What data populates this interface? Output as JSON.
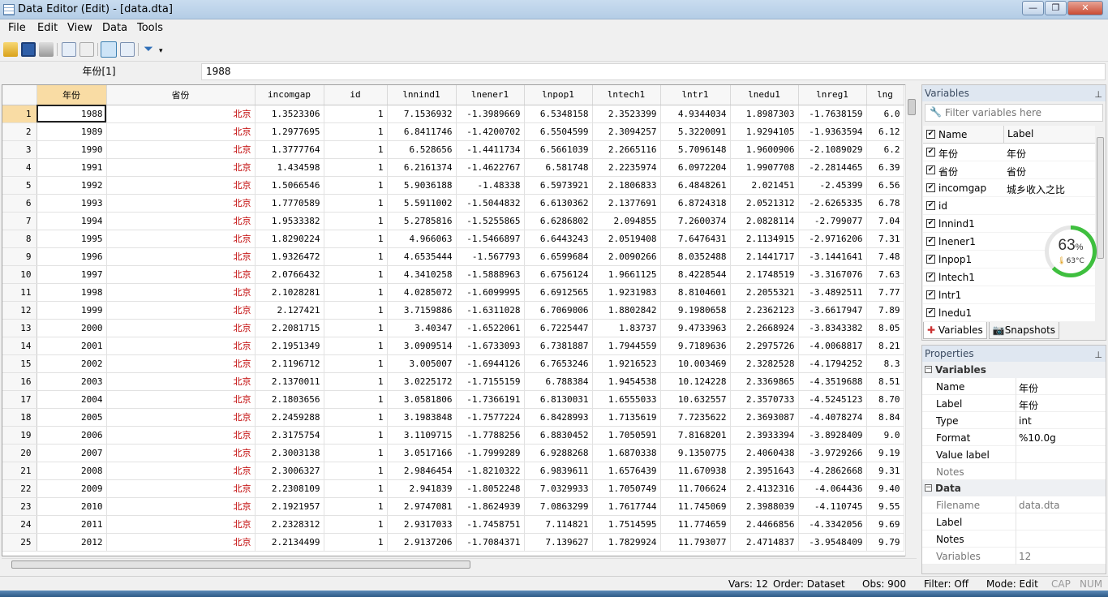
{
  "window": {
    "title": "Data Editor (Edit) - [data.dta]"
  },
  "menu": [
    "File",
    "Edit",
    "View",
    "Data",
    "Tools"
  ],
  "cellbar": {
    "ref": "年份[1]",
    "value": "1988"
  },
  "grid": {
    "columns": [
      "年份",
      "省份",
      "incomgap",
      "id",
      "lnnind1",
      "lnener1",
      "lnpop1",
      "lntech1",
      "lntr1",
      "lnedu1",
      "lnreg1",
      "lng"
    ],
    "rows": [
      [
        "1",
        "1988",
        "北京",
        "1.3523306",
        "1",
        "7.1536932",
        "-1.3989669",
        "6.5348158",
        "2.3523399",
        "4.9344034",
        "1.8987303",
        "-1.7638159",
        "6.0"
      ],
      [
        "2",
        "1989",
        "北京",
        "1.2977695",
        "1",
        "6.8411746",
        "-1.4200702",
        "6.5504599",
        "2.3094257",
        "5.3220091",
        "1.9294105",
        "-1.9363594",
        "6.12"
      ],
      [
        "3",
        "1990",
        "北京",
        "1.3777764",
        "1",
        "6.528656",
        "-1.4411734",
        "6.5661039",
        "2.2665116",
        "5.7096148",
        "1.9600906",
        "-2.1089029",
        "6.2"
      ],
      [
        "4",
        "1991",
        "北京",
        "1.434598",
        "1",
        "6.2161374",
        "-1.4622767",
        "6.581748",
        "2.2235974",
        "6.0972204",
        "1.9907708",
        "-2.2814465",
        "6.39"
      ],
      [
        "5",
        "1992",
        "北京",
        "1.5066546",
        "1",
        "5.9036188",
        "-1.48338",
        "6.5973921",
        "2.1806833",
        "6.4848261",
        "2.021451",
        "-2.45399",
        "6.56"
      ],
      [
        "6",
        "1993",
        "北京",
        "1.7770589",
        "1",
        "5.5911002",
        "-1.5044832",
        "6.6130362",
        "2.1377691",
        "6.8724318",
        "2.0521312",
        "-2.6265335",
        "6.78"
      ],
      [
        "7",
        "1994",
        "北京",
        "1.9533382",
        "1",
        "5.2785816",
        "-1.5255865",
        "6.6286802",
        "2.094855",
        "7.2600374",
        "2.0828114",
        "-2.799077",
        "7.04"
      ],
      [
        "8",
        "1995",
        "北京",
        "1.8290224",
        "1",
        "4.966063",
        "-1.5466897",
        "6.6443243",
        "2.0519408",
        "7.6476431",
        "2.1134915",
        "-2.9716206",
        "7.31"
      ],
      [
        "9",
        "1996",
        "北京",
        "1.9326472",
        "1",
        "4.6535444",
        "-1.567793",
        "6.6599684",
        "2.0090266",
        "8.0352488",
        "2.1441717",
        "-3.1441641",
        "7.48"
      ],
      [
        "10",
        "1997",
        "北京",
        "2.0766432",
        "1",
        "4.3410258",
        "-1.5888963",
        "6.6756124",
        "1.9661125",
        "8.4228544",
        "2.1748519",
        "-3.3167076",
        "7.63"
      ],
      [
        "11",
        "1998",
        "北京",
        "2.1028281",
        "1",
        "4.0285072",
        "-1.6099995",
        "6.6912565",
        "1.9231983",
        "8.8104601",
        "2.2055321",
        "-3.4892511",
        "7.77"
      ],
      [
        "12",
        "1999",
        "北京",
        "2.127421",
        "1",
        "3.7159886",
        "-1.6311028",
        "6.7069006",
        "1.8802842",
        "9.1980658",
        "2.2362123",
        "-3.6617947",
        "7.89"
      ],
      [
        "13",
        "2000",
        "北京",
        "2.2081715",
        "1",
        "3.40347",
        "-1.6522061",
        "6.7225447",
        "1.83737",
        "9.4733963",
        "2.2668924",
        "-3.8343382",
        "8.05"
      ],
      [
        "14",
        "2001",
        "北京",
        "2.1951349",
        "1",
        "3.0909514",
        "-1.6733093",
        "6.7381887",
        "1.7944559",
        "9.7189636",
        "2.2975726",
        "-4.0068817",
        "8.21"
      ],
      [
        "15",
        "2002",
        "北京",
        "2.1196712",
        "1",
        "3.005007",
        "-1.6944126",
        "6.7653246",
        "1.9216523",
        "10.003469",
        "2.3282528",
        "-4.1794252",
        "8.3"
      ],
      [
        "16",
        "2003",
        "北京",
        "2.1370011",
        "1",
        "3.0225172",
        "-1.7155159",
        "6.788384",
        "1.9454538",
        "10.124228",
        "2.3369865",
        "-4.3519688",
        "8.51"
      ],
      [
        "17",
        "2004",
        "北京",
        "2.1803656",
        "1",
        "3.0581806",
        "-1.7366191",
        "6.8130031",
        "1.6555033",
        "10.632557",
        "2.3570733",
        "-4.5245123",
        "8.70"
      ],
      [
        "18",
        "2005",
        "北京",
        "2.2459288",
        "1",
        "3.1983848",
        "-1.7577224",
        "6.8428993",
        "1.7135619",
        "7.7235622",
        "2.3693087",
        "-4.4078274",
        "8.84"
      ],
      [
        "19",
        "2006",
        "北京",
        "2.3175754",
        "1",
        "3.1109715",
        "-1.7788256",
        "6.8830452",
        "1.7050591",
        "7.8168201",
        "2.3933394",
        "-3.8928409",
        "9.0"
      ],
      [
        "20",
        "2007",
        "北京",
        "2.3003138",
        "1",
        "3.0517166",
        "-1.7999289",
        "6.9288268",
        "1.6870338",
        "9.1350775",
        "2.4060438",
        "-3.9729266",
        "9.19"
      ],
      [
        "21",
        "2008",
        "北京",
        "2.3006327",
        "1",
        "2.9846454",
        "-1.8210322",
        "6.9839611",
        "1.6576439",
        "11.670938",
        "2.3951643",
        "-4.2862668",
        "9.31"
      ],
      [
        "22",
        "2009",
        "北京",
        "2.2308109",
        "1",
        "2.941839",
        "-1.8052248",
        "7.0329933",
        "1.7050749",
        "11.706624",
        "2.4132316",
        "-4.064436",
        "9.40"
      ],
      [
        "23",
        "2010",
        "北京",
        "2.1921957",
        "1",
        "2.9747081",
        "-1.8624939",
        "7.0863299",
        "1.7617744",
        "11.745069",
        "2.3988039",
        "-4.110745",
        "9.55"
      ],
      [
        "24",
        "2011",
        "北京",
        "2.2328312",
        "1",
        "2.9317033",
        "-1.7458751",
        "7.114821",
        "1.7514595",
        "11.774659",
        "2.4466856",
        "-4.3342056",
        "9.69"
      ],
      [
        "25",
        "2012",
        "北京",
        "2.2134499",
        "1",
        "2.9137206",
        "-1.7084371",
        "7.139627",
        "1.7829924",
        "11.793077",
        "2.4714837",
        "-3.9548409",
        "9.79"
      ]
    ]
  },
  "variables_panel": {
    "title": "Variables",
    "filter_placeholder": "Filter variables here",
    "col_name": "Name",
    "col_label": "Label",
    "items": [
      {
        "name": "年份",
        "label": "年份"
      },
      {
        "name": "省份",
        "label": "省份"
      },
      {
        "name": "incomgap",
        "label": "城乡收入之比"
      },
      {
        "name": "id",
        "label": ""
      },
      {
        "name": "lnnind1",
        "label": ""
      },
      {
        "name": "lnener1",
        "label": ""
      },
      {
        "name": "lnpop1",
        "label": ""
      },
      {
        "name": "lntech1",
        "label": ""
      },
      {
        "name": "lntr1",
        "label": ""
      },
      {
        "name": "lnedu1",
        "label": ""
      }
    ],
    "tabs": [
      "Variables",
      "Snapshots"
    ]
  },
  "properties_panel": {
    "title": "Properties",
    "section_variables": "Variables",
    "variables": [
      {
        "key": "Name",
        "value": "年份"
      },
      {
        "key": "Label",
        "value": "年份"
      },
      {
        "key": "Type",
        "value": "int"
      },
      {
        "key": "Format",
        "value": "%10.0g"
      },
      {
        "key": "Value label",
        "value": ""
      },
      {
        "key": "Notes",
        "value": ""
      }
    ],
    "section_data": "Data",
    "data": [
      {
        "key": "Filename",
        "value": "data.dta"
      },
      {
        "key": "Label",
        "value": ""
      },
      {
        "key": "Notes",
        "value": ""
      },
      {
        "key": "Variables",
        "value": "12"
      }
    ]
  },
  "gauge": {
    "percent": "63",
    "unit": "%",
    "temp": "63°C",
    "fraction": 0.63
  },
  "status": {
    "vars": "Vars: 12",
    "order": "Order: Dataset",
    "obs": "Obs: 900",
    "filter": "Filter: Off",
    "mode": "Mode: Edit",
    "cap": "CAP",
    "num": "NUM"
  }
}
